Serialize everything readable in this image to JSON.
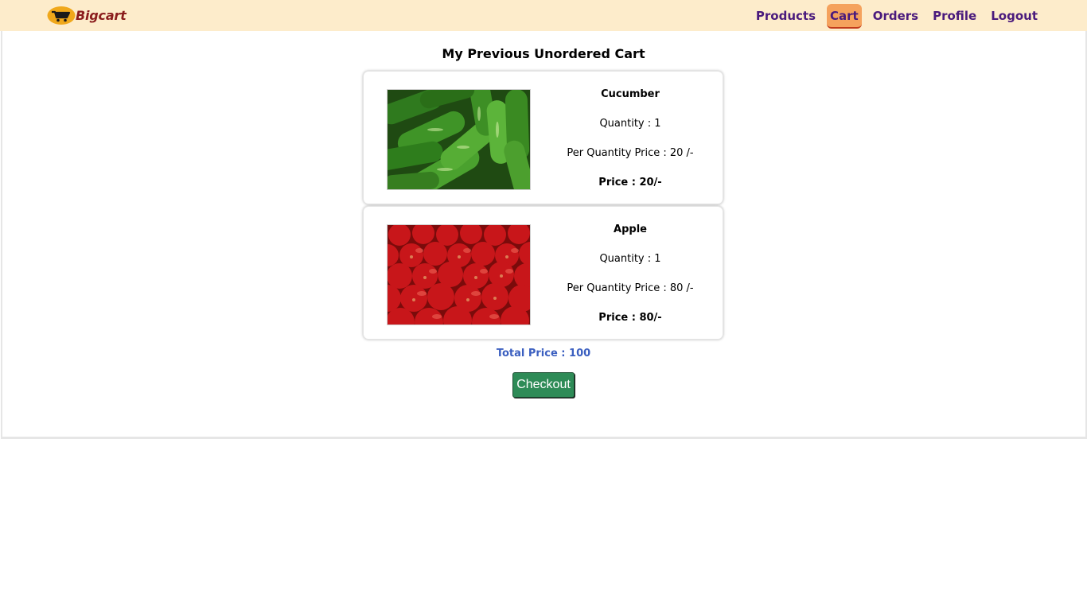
{
  "brand": {
    "name": "Bigcart"
  },
  "nav": {
    "items": [
      {
        "label": "Products"
      },
      {
        "label": "Cart"
      },
      {
        "label": "Orders"
      },
      {
        "label": "Profile"
      },
      {
        "label": "Logout"
      }
    ],
    "active": "Cart"
  },
  "page": {
    "title": "My Previous Unordered Cart"
  },
  "cart": {
    "items": [
      {
        "name": "Cucumber",
        "quantity": "Quantity : 1",
        "per_quantity_price": "Per Quantity Price : 20 /-",
        "price": "Price : 20/-",
        "image": "cucumber-photo"
      },
      {
        "name": "Apple",
        "quantity": "Quantity : 1",
        "per_quantity_price": "Per Quantity Price : 80 /-",
        "price": "Price : 80/-",
        "image": "apple-photo"
      }
    ],
    "total": "Total Price : 100",
    "checkout_label": "Checkout"
  },
  "colors": {
    "navbar_bg": "#fdeccb",
    "nav_text": "#4a1a7d",
    "active_tab_bg": "#f5a25d",
    "brand": "#8b1d1d",
    "total_text": "#3b5fc0",
    "checkout_bg": "#2e8b57"
  }
}
